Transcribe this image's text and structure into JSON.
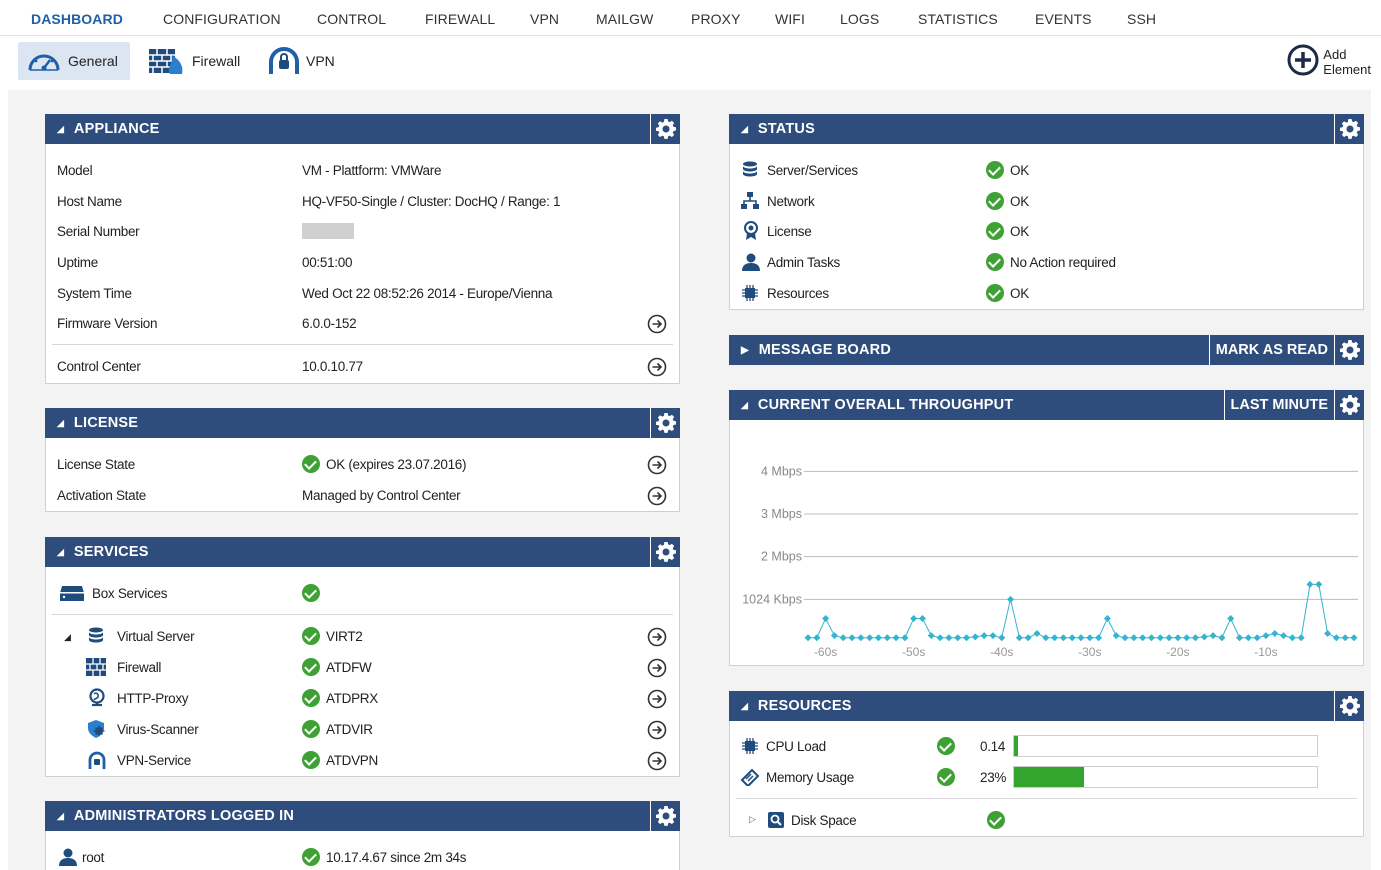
{
  "nav": {
    "items": [
      "DASHBOARD",
      "CONFIGURATION",
      "CONTROL",
      "FIREWALL",
      "VPN",
      "MAILGW",
      "PROXY",
      "WIFI",
      "LOGS",
      "STATISTICS",
      "EVENTS",
      "SSH"
    ],
    "active": "DASHBOARD"
  },
  "subnav": {
    "tabs": [
      {
        "label": "General",
        "icon": "speedometer-icon",
        "active": true
      },
      {
        "label": "Firewall",
        "icon": "firewall-icon",
        "active": false
      },
      {
        "label": "VPN",
        "icon": "vpn-icon",
        "active": false
      }
    ],
    "add_element_line1": "Add",
    "add_element_line2": "Element"
  },
  "appliance": {
    "title": "APPLIANCE",
    "rows": [
      {
        "label": "Model",
        "value": "VM - Plattform: VMWare"
      },
      {
        "label": "Host Name",
        "value": "HQ-VF50-Single / Cluster: DocHQ / Range: 1"
      },
      {
        "label": "Serial Number",
        "value": ""
      },
      {
        "label": "Uptime",
        "value": "00:51:00"
      },
      {
        "label": "System Time",
        "value": "Wed Oct 22 08:52:26 2014 - Europe/Vienna"
      },
      {
        "label": "Firmware Version",
        "value": "6.0.0-152"
      },
      {
        "label": "Control Center",
        "value": "10.0.10.77"
      }
    ]
  },
  "license": {
    "title": "LICENSE",
    "rows": [
      {
        "label": "License State",
        "value": "OK (expires 23.07.2016)"
      },
      {
        "label": "Activation State",
        "value": "Managed by Control Center"
      }
    ]
  },
  "services": {
    "title": "SERVICES",
    "box_services": "Box Services",
    "items": [
      {
        "label": "Virtual Server",
        "value": "VIRT2",
        "icon": "database-icon"
      },
      {
        "label": "Firewall",
        "value": "ATDFW",
        "icon": "firewall-icon"
      },
      {
        "label": "HTTP-Proxy",
        "value": "ATDPRX",
        "icon": "globe-icon"
      },
      {
        "label": "Virus-Scanner",
        "value": "ATDVIR",
        "icon": "virus-shield-icon"
      },
      {
        "label": "VPN-Service",
        "value": "ATDVPN",
        "icon": "vpn-icon"
      }
    ]
  },
  "admins": {
    "title": "ADMINISTRATORS LOGGED IN",
    "rows": [
      {
        "label": "root",
        "value": "10.17.4.67 since  2m 34s"
      }
    ]
  },
  "status": {
    "title": "STATUS",
    "rows": [
      {
        "label": "Server/Services",
        "value": "OK",
        "icon": "database-icon"
      },
      {
        "label": "Network",
        "value": "OK",
        "icon": "network-icon"
      },
      {
        "label": "License",
        "value": "OK",
        "icon": "license-badge-icon"
      },
      {
        "label": "Admin Tasks",
        "value": "No Action required",
        "icon": "user-icon"
      },
      {
        "label": "Resources",
        "value": "OK",
        "icon": "chip-icon"
      }
    ]
  },
  "message_board": {
    "title": "MESSAGE BOARD",
    "button": "MARK AS READ"
  },
  "throughput": {
    "title": "CURRENT OVERALL THROUGHPUT",
    "button": "LAST MINUTE"
  },
  "resources": {
    "title": "RESOURCES",
    "rows": [
      {
        "label": "CPU Load",
        "value": "0.14",
        "fill": 0.014
      },
      {
        "label": "Memory Usage",
        "value": "23%",
        "fill": 0.23
      }
    ],
    "disk_space": "Disk Space"
  },
  "colors": {
    "header": "#2e4c7c",
    "accent": "#1f5fa8",
    "ok_green": "#3ea134",
    "series": "#34b4cf"
  },
  "chart_data": {
    "type": "line",
    "title": "",
    "xlabel": "",
    "ylabel": "",
    "x_ticks": [
      "-60s",
      "-50s",
      "-40s",
      "-30s",
      "-20s",
      "-10s"
    ],
    "y_ticks": [
      "1024 Kbps",
      "2 Mbps",
      "3 Mbps",
      "4 Mbps"
    ],
    "ylim_mbps": [
      0,
      4.5
    ],
    "xlim_s": [
      -62,
      0
    ],
    "grid": true,
    "series": [
      {
        "x": [
          -62,
          -61,
          -60,
          -59,
          -58,
          -57,
          -56,
          -55,
          -54,
          -53,
          -52,
          -51,
          -50,
          -49,
          -48,
          -47,
          -46,
          -45,
          -44,
          -43,
          -42,
          -41,
          -40,
          -39,
          -38,
          -37,
          -36,
          -35,
          -34,
          -33,
          -32,
          -31,
          -30,
          -29,
          -28,
          -27,
          -26,
          -25,
          -24,
          -23,
          -22,
          -21,
          -20,
          -19,
          -18,
          -17,
          -16,
          -15,
          -14,
          -13,
          -12,
          -11,
          -10,
          -9,
          -8,
          -7,
          -6,
          -5,
          -4,
          -3,
          -2,
          -1,
          0
        ],
        "y": [
          0.1,
          0.1,
          0.55,
          0.15,
          0.1,
          0.1,
          0.1,
          0.1,
          0.1,
          0.1,
          0.1,
          0.1,
          0.55,
          0.55,
          0.15,
          0.1,
          0.1,
          0.1,
          0.1,
          0.12,
          0.15,
          0.15,
          0.1,
          1.0,
          0.1,
          0.1,
          0.2,
          0.1,
          0.1,
          0.1,
          0.1,
          0.1,
          0.1,
          0.1,
          0.55,
          0.15,
          0.1,
          0.1,
          0.1,
          0.1,
          0.1,
          0.1,
          0.1,
          0.1,
          0.1,
          0.12,
          0.15,
          0.1,
          0.55,
          0.1,
          0.1,
          0.1,
          0.15,
          0.2,
          0.15,
          0.1,
          0.1,
          1.35,
          1.35,
          0.2,
          0.1,
          0.1,
          0.1
        ]
      }
    ]
  }
}
